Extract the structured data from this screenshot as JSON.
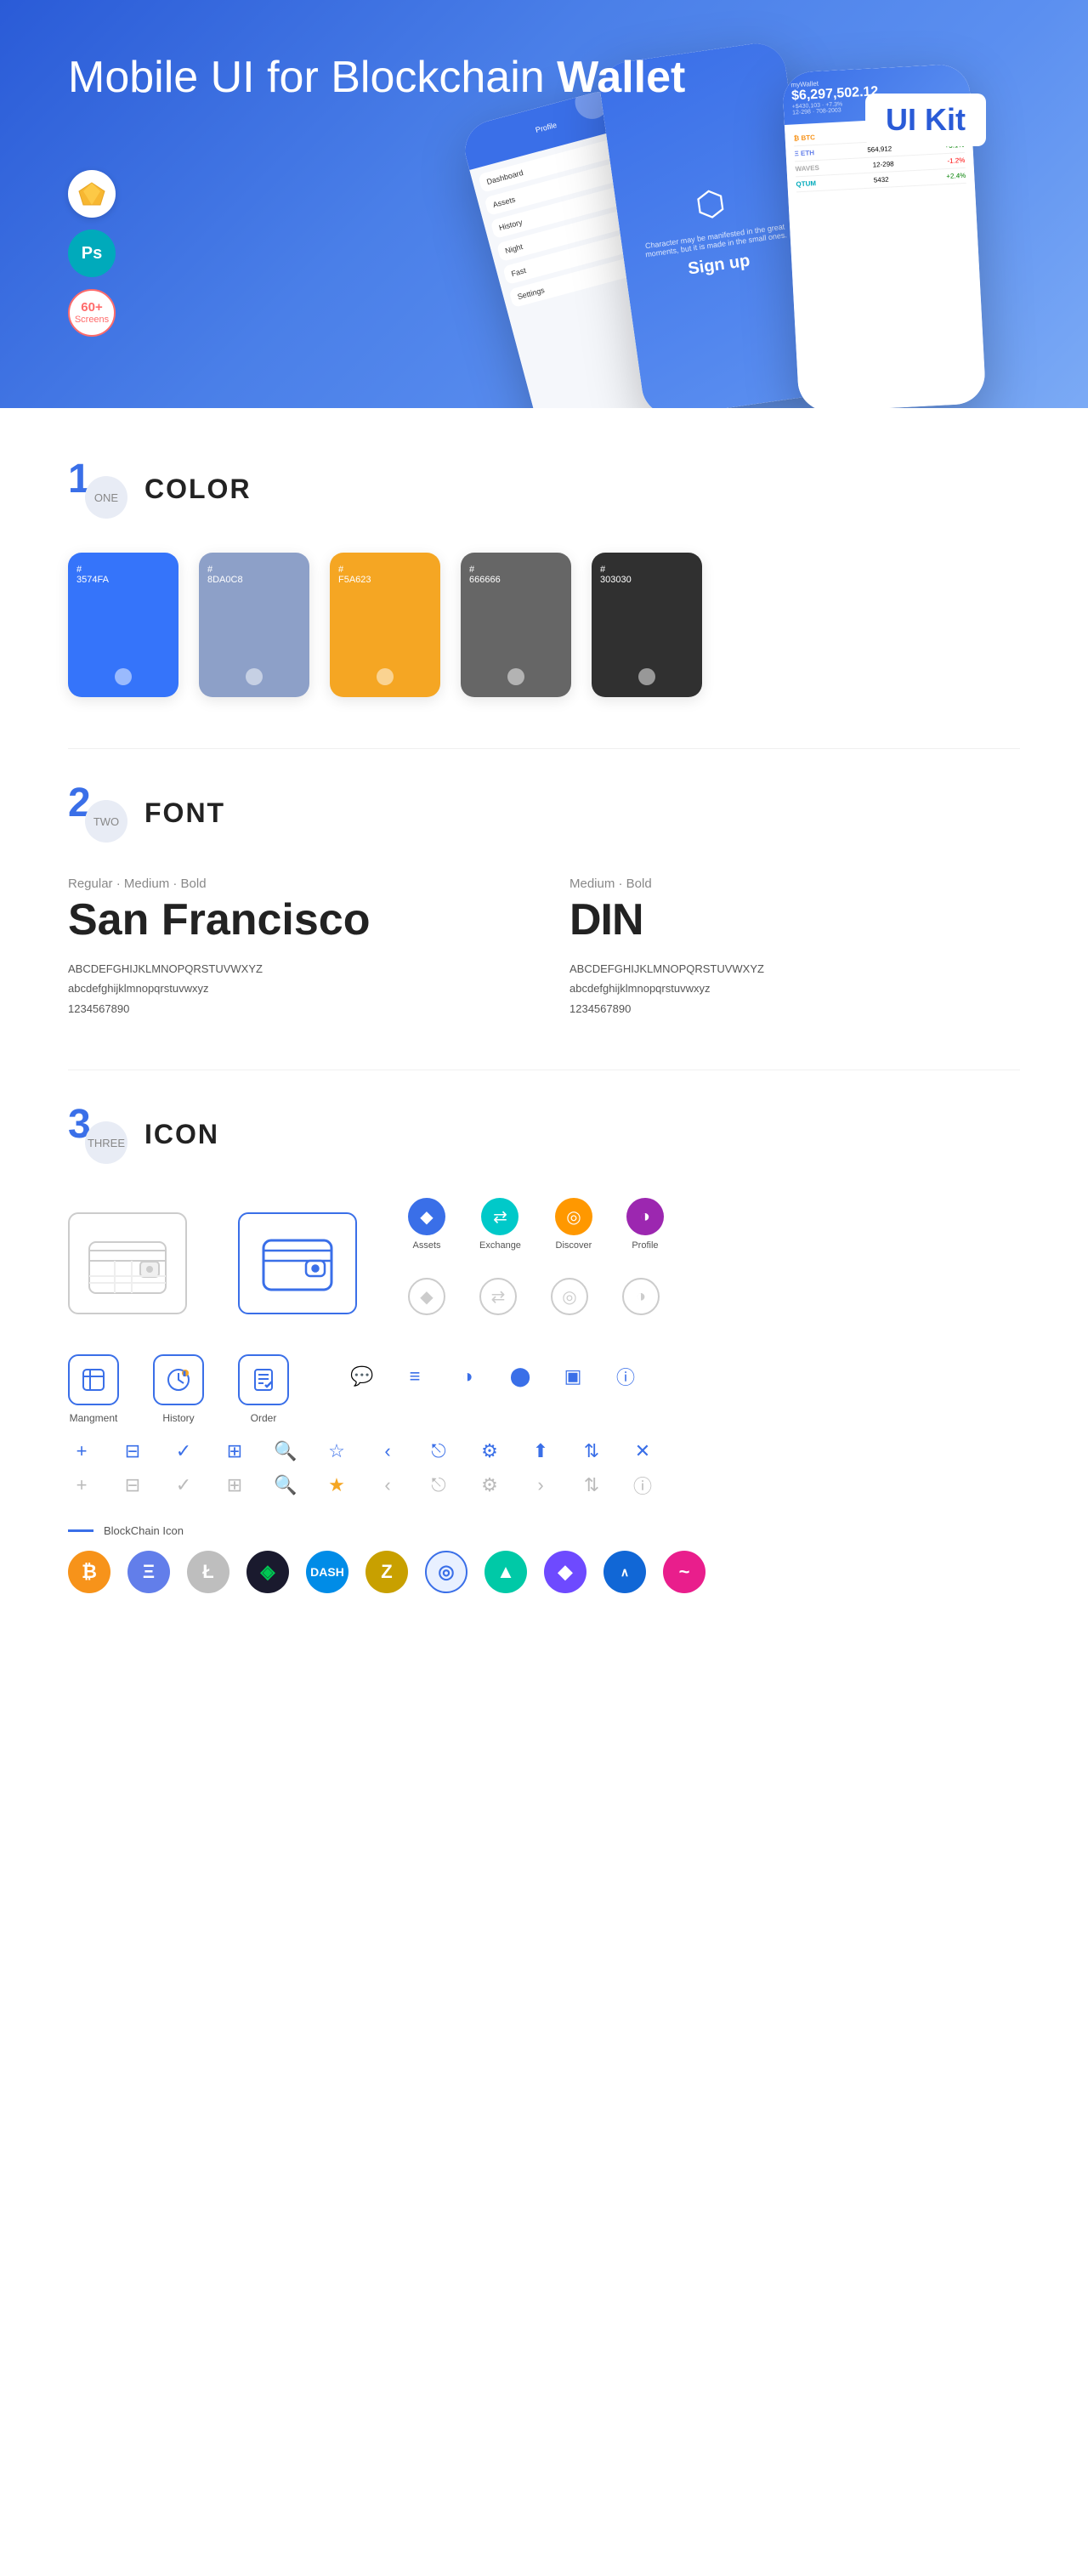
{
  "hero": {
    "title": "Mobile UI for Blockchain ",
    "title_bold": "Wallet",
    "badge": "UI Kit",
    "badge_sketch": "Sketch",
    "badge_ps": "Ps",
    "badge_screens": "60+\nScreens"
  },
  "sections": {
    "color": {
      "number": "1",
      "number_label": "ONE",
      "title": "COLOR",
      "swatches": [
        {
          "hex": "#3574FA",
          "label": "#\n3574FA"
        },
        {
          "hex": "#8DA0C8",
          "label": "#\n8DA0C8"
        },
        {
          "hex": "#F5A623",
          "label": "#\nF5A623"
        },
        {
          "hex": "#666666",
          "label": "#\n666666"
        },
        {
          "hex": "#303030",
          "label": "#\n303030"
        }
      ]
    },
    "font": {
      "number": "2",
      "number_label": "TWO",
      "title": "FONT",
      "fonts": [
        {
          "style": "Regular · Medium · Bold",
          "name": "San Francisco",
          "upper": "ABCDEFGHIJKLMNOPQRSTUVWXYZ",
          "lower": "abcdefghijklmnopqrstuvwxyz",
          "digits": "1234567890"
        },
        {
          "style": "Medium · Bold",
          "name": "DIN",
          "upper": "ABCDEFGHIJKLMNOPQRSTUVWXYZ",
          "lower": "abcdefghijklmnopqrstuvwxyz",
          "digits": "1234567890"
        }
      ]
    },
    "icon": {
      "number": "3",
      "number_label": "THREE",
      "title": "ICON",
      "tab_icons": [
        {
          "label": "Assets",
          "icon": "◆"
        },
        {
          "label": "Exchange",
          "icon": "⇄"
        },
        {
          "label": "Discover",
          "icon": "◉"
        },
        {
          "label": "Profile",
          "icon": "◑"
        }
      ],
      "app_icons": [
        {
          "label": "Mangment",
          "icon": "▣"
        },
        {
          "label": "History",
          "icon": "⏱"
        },
        {
          "label": "Order",
          "icon": "≡"
        }
      ],
      "blockchain_label": "BlockChain Icon",
      "coins": [
        {
          "symbol": "₿",
          "bg": "#f7931a",
          "color": "white"
        },
        {
          "symbol": "Ξ",
          "bg": "#627eea",
          "color": "white"
        },
        {
          "symbol": "Ł",
          "bg": "#bebebe",
          "color": "white"
        },
        {
          "symbol": "◈",
          "bg": "#1a1a2e",
          "color": "white"
        },
        {
          "symbol": "D",
          "bg": "#008ce7",
          "color": "white"
        },
        {
          "symbol": "Z",
          "bg": "#c8a000",
          "color": "white"
        },
        {
          "symbol": "◎",
          "bg": "#3a6fe8",
          "color": "white"
        },
        {
          "symbol": "▲",
          "bg": "#00c9a7",
          "color": "white"
        },
        {
          "symbol": "◆",
          "bg": "#6e4aff",
          "color": "white"
        },
        {
          "symbol": "∞",
          "bg": "#e91e8c",
          "color": "white"
        },
        {
          "symbol": "~",
          "bg": "#00aabb",
          "color": "white"
        }
      ]
    }
  }
}
